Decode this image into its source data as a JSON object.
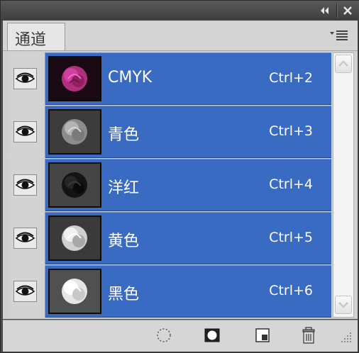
{
  "panel": {
    "tab_label": "通道",
    "collapse_icon": "double-chevron-left-icon",
    "close_icon": "close-icon",
    "menu_icon": "panel-menu-icon"
  },
  "channels": [
    {
      "name": "CMYK",
      "shortcut": "Ctrl+2",
      "visible": true,
      "thumb": "composite-color"
    },
    {
      "name": "青色",
      "shortcut": "Ctrl+3",
      "visible": true,
      "thumb": "gray-light"
    },
    {
      "name": "洋红",
      "shortcut": "Ctrl+4",
      "visible": true,
      "thumb": "gray-dark"
    },
    {
      "name": "黄色",
      "shortcut": "Ctrl+5",
      "visible": true,
      "thumb": "gray-bright"
    },
    {
      "name": "黑色",
      "shortcut": "Ctrl+6",
      "visible": true,
      "thumb": "gray-brightest"
    }
  ],
  "toolbar": {
    "load_selection_icon": "dotted-circle-icon",
    "save_selection_icon": "mask-icon",
    "new_channel_icon": "new-page-icon",
    "delete_icon": "trash-icon"
  },
  "colors": {
    "selection": "#3a6bc2",
    "panel_bg": "#d0d0d0"
  }
}
